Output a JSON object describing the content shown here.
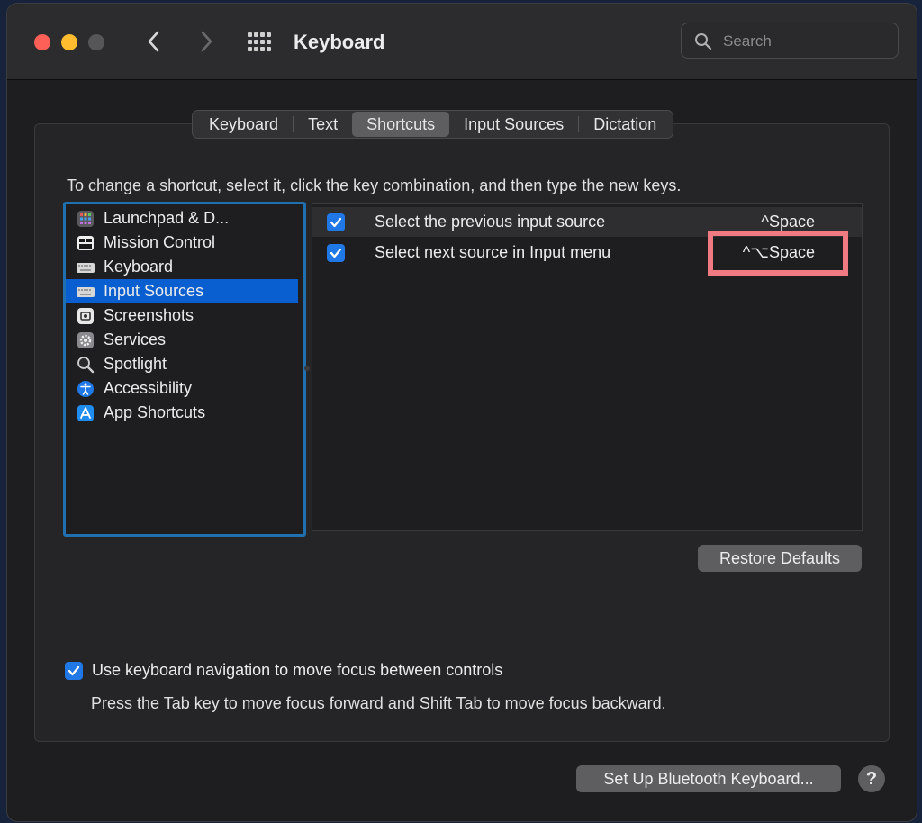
{
  "window": {
    "title": "Keyboard"
  },
  "search": {
    "placeholder": "Search"
  },
  "tabs": [
    {
      "label": "Keyboard"
    },
    {
      "label": "Text"
    },
    {
      "label": "Shortcuts"
    },
    {
      "label": "Input Sources"
    },
    {
      "label": "Dictation"
    }
  ],
  "active_tab": "Shortcuts",
  "instruction": "To change a shortcut, select it, click the key combination, and then type the new keys.",
  "categories": [
    {
      "label": "Launchpad & D...",
      "icon": "launchpad-icon"
    },
    {
      "label": "Mission Control",
      "icon": "mission-control-icon"
    },
    {
      "label": "Keyboard",
      "icon": "keyboard-icon"
    },
    {
      "label": "Input Sources",
      "icon": "keyboard-icon"
    },
    {
      "label": "Screenshots",
      "icon": "screenshot-icon"
    },
    {
      "label": "Services",
      "icon": "gear-icon"
    },
    {
      "label": "Spotlight",
      "icon": "magnifier-icon"
    },
    {
      "label": "Accessibility",
      "icon": "accessibility-icon"
    },
    {
      "label": "App Shortcuts",
      "icon": "app-store-icon"
    }
  ],
  "selected_category": "Input Sources",
  "shortcuts": [
    {
      "label": "Select the previous input source",
      "key": "^Space",
      "checked": true
    },
    {
      "label": "Select next source in Input menu",
      "key": "^⌥Space",
      "checked": true
    }
  ],
  "buttons": {
    "restore_defaults": "Restore Defaults",
    "bluetooth": "Set Up Bluetooth Keyboard...",
    "help": "?"
  },
  "keyboard_navigation": {
    "label": "Use keyboard navigation to move focus between controls",
    "description": "Press the Tab key to move focus forward and Shift Tab to move focus backward.",
    "checked": true
  },
  "colors": {
    "accent": "#1f78e6",
    "selection": "#0a5fd0",
    "highlight_box": "#f07a82"
  }
}
